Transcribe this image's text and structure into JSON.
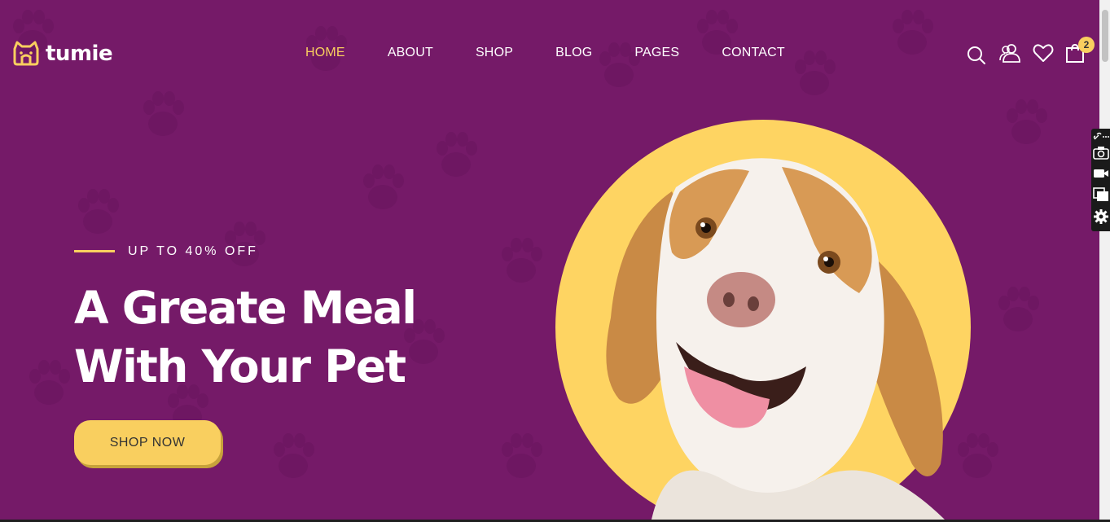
{
  "brand": {
    "name": "tumie",
    "logo_icon": "cat-house-icon"
  },
  "nav": {
    "items": [
      {
        "label": "HOME",
        "active": true
      },
      {
        "label": "ABOUT",
        "active": false
      },
      {
        "label": "SHOP",
        "active": false
      },
      {
        "label": "BLOG",
        "active": false
      },
      {
        "label": "PAGES",
        "active": false
      },
      {
        "label": "CONTACT",
        "active": false
      }
    ]
  },
  "header_icons": {
    "search": "search-icon",
    "account": "users-icon",
    "wishlist": "heart-icon",
    "cart": "cart-icon",
    "cart_count": "2"
  },
  "hero": {
    "offer": "UP TO 40% OFF",
    "headline_line1": "A Greate Meal",
    "headline_line2": "With Your Pet",
    "cta_label": "SHOP NOW",
    "image": "smiling beagle dog on yellow circle"
  },
  "side_toolbar": [
    "link-icon",
    "camera-icon",
    "video-icon",
    "copy-icon",
    "gear-icon"
  ],
  "colors": {
    "background": "#751a68",
    "accent": "#f9cf5f",
    "text": "#ffffff"
  }
}
